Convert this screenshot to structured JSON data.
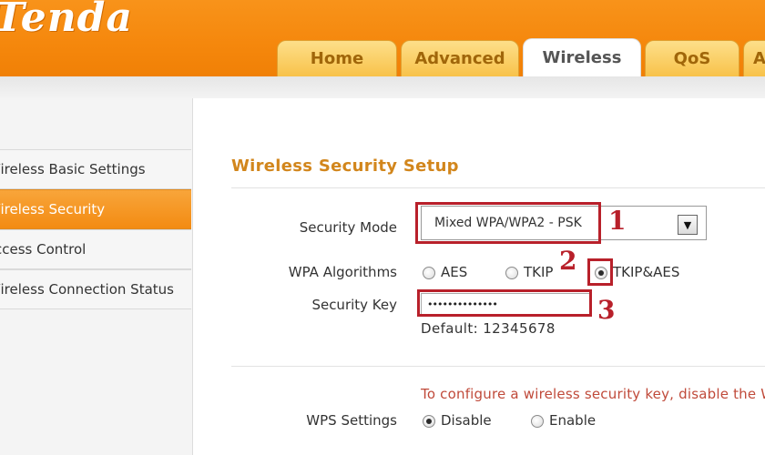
{
  "header": {
    "logo_text": "Tenda",
    "tabs": [
      {
        "label": "Home"
      },
      {
        "label": "Advanced"
      },
      {
        "label": "Wireless"
      },
      {
        "label": "QoS"
      },
      {
        "label": "A"
      }
    ]
  },
  "sidebar": {
    "items": [
      {
        "label": "Wireless Basic Settings"
      },
      {
        "label": "Wireless Security"
      },
      {
        "label": "Access Control"
      },
      {
        "label": "Wireless Connection Status"
      }
    ]
  },
  "main": {
    "section_title": "Wireless Security Setup",
    "security_mode": {
      "label": "Security Mode",
      "value": "Mixed WPA/WPA2 - PSK"
    },
    "wpa_algorithms": {
      "label": "WPA Algorithms",
      "options": [
        {
          "label": "AES",
          "checked": false
        },
        {
          "label": "TKIP",
          "checked": false
        },
        {
          "label": "TKIP&AES",
          "checked": true
        }
      ]
    },
    "security_key": {
      "label": "Security Key",
      "value": "••••••••••••••",
      "default_text": "Default: 12345678"
    },
    "wps_note": "To configure a wireless security key, disable the W",
    "wps_settings": {
      "label": "WPS Settings",
      "options": [
        {
          "label": "Disable",
          "checked": true
        },
        {
          "label": "Enable",
          "checked": false
        }
      ]
    }
  },
  "annotations": [
    {
      "number": "1"
    },
    {
      "number": "2"
    },
    {
      "number": "3"
    }
  ],
  "colors": {
    "accent_orange": "#f5870c",
    "title_orange": "#d2861c",
    "annotation_red": "#b8202a",
    "note_red": "#c04a3a"
  }
}
